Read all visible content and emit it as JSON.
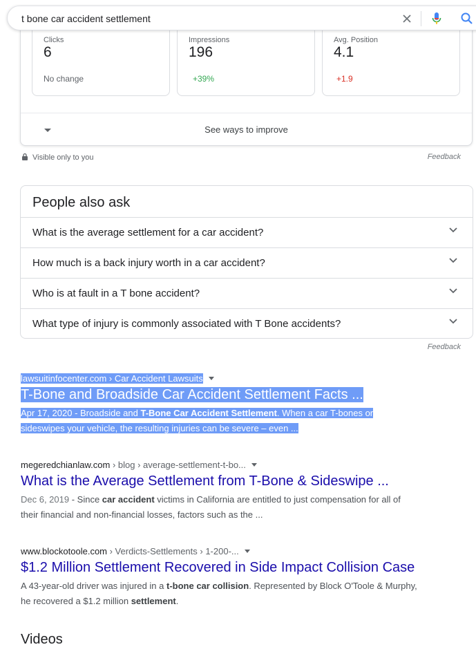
{
  "search": {
    "query": "t bone car accident settlement"
  },
  "stats": {
    "boxes": [
      {
        "label": "Clicks",
        "value": "6",
        "change": "No change"
      },
      {
        "label": "Impressions",
        "value": "196",
        "change": "+39%"
      },
      {
        "label": "Avg. Position",
        "value": "4.1",
        "change": "+1.9"
      }
    ],
    "see_ways": "See ways to improve",
    "visible_only": "Visible only to you",
    "feedback": "Feedback"
  },
  "paa": {
    "title": "People also ask",
    "questions": [
      "What is the average settlement for a car accident?",
      "How much is a back injury worth in a car accident?",
      "Who is at fault in a T bone accident?",
      "What type of injury is commonly associated with T Bone accidents?"
    ],
    "feedback": "Feedback"
  },
  "results": [
    {
      "domain": "lawsuitinfocenter.com",
      "path": " › Car Accident Lawsuits",
      "title": "T-Bone and Broadside Car Accident Settlement Facts ...",
      "date": "Apr 17, 2020",
      "snippet_a": " - Broadside and ",
      "snippet_b1": "T-Bone Car Accident Settlement",
      "snippet_c": ". When a car T-bones or",
      "snippet_d": "sideswipes your vehicle, the resulting injuries can be severe – even ..."
    },
    {
      "domain": "megeredchianlaw.com",
      "path": " › blog › average-settlement-t-bo...",
      "title": "What is the Average Settlement from T-Bone & Sideswipe ...",
      "date": "Dec 6, 2019",
      "snippet_a": " - Since ",
      "snippet_b1": "car accident",
      "snippet_c": " victims in California are entitled to just compensation for all of",
      "snippet_d": "their financial and non-financial losses, factors such as the ..."
    },
    {
      "domain": "www.blockotoole.com",
      "path": " › Verdicts-Settlements › 1-200-...",
      "title": "$1.2 Million Settlement Recovered in Side Impact Collision Case",
      "snippet_a": "A 43-year-old driver was injured in a ",
      "snippet_b1": "t-bone car collision",
      "snippet_c": ". Represented by Block O'Toole & Murphy,",
      "snippet_d1": "he recovered a $1.2 million ",
      "snippet_d2": "settlement",
      "snippet_d3": "."
    }
  ],
  "videos_heading": "Videos"
}
